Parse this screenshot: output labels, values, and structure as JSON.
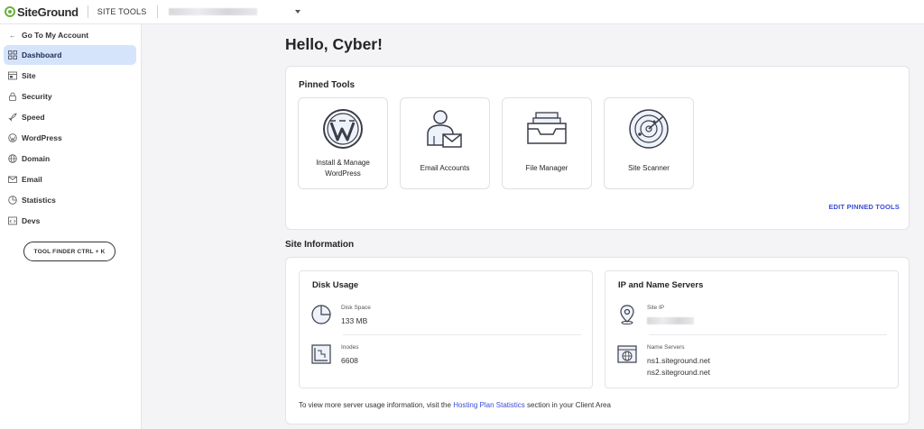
{
  "header": {
    "logo_text": "SiteGround",
    "site_tools_label": "SITE TOOLS"
  },
  "sidebar": {
    "back_link": "Go To My Account",
    "items": [
      {
        "label": "Dashboard",
        "icon": "grid-icon",
        "active": true
      },
      {
        "label": "Site",
        "icon": "site-icon"
      },
      {
        "label": "Security",
        "icon": "lock-icon"
      },
      {
        "label": "Speed",
        "icon": "rocket-icon"
      },
      {
        "label": "WordPress",
        "icon": "wordpress-icon"
      },
      {
        "label": "Domain",
        "icon": "globe-icon"
      },
      {
        "label": "Email",
        "icon": "envelope-icon"
      },
      {
        "label": "Statistics",
        "icon": "pie-chart-icon"
      },
      {
        "label": "Devs",
        "icon": "code-icon"
      }
    ],
    "tool_finder_label": "TOOL FINDER CTRL + K"
  },
  "main": {
    "greeting": "Hello, Cyber!",
    "pinned": {
      "title": "Pinned Tools",
      "tiles": [
        {
          "label": "Install & Manage WordPress",
          "icon": "wordpress-logo-icon"
        },
        {
          "label": "Email Accounts",
          "icon": "user-mail-icon"
        },
        {
          "label": "File Manager",
          "icon": "file-tray-icon"
        },
        {
          "label": "Site Scanner",
          "icon": "radar-icon"
        }
      ],
      "edit_label": "EDIT PINNED TOOLS"
    },
    "site_info": {
      "title": "Site Information",
      "disk_usage": {
        "title": "Disk Usage",
        "disk_space_label": "Disk Space",
        "disk_space_value": "133 MB",
        "inodes_label": "Inodes",
        "inodes_value": "6608"
      },
      "servers": {
        "title": "IP and Name Servers",
        "site_ip_label": "Site IP",
        "name_servers_label": "Name Servers",
        "ns1": "ns1.siteground.net",
        "ns2": "ns2.siteground.net"
      },
      "footer_prefix": "To view more server usage information, visit the ",
      "footer_link": "Hosting Plan Statistics",
      "footer_suffix": " section in your Client Area"
    }
  },
  "colors": {
    "accent_link": "#3b4bd8",
    "active_nav_bg": "#d5e4fb",
    "brand_green": "#6bb13c"
  }
}
